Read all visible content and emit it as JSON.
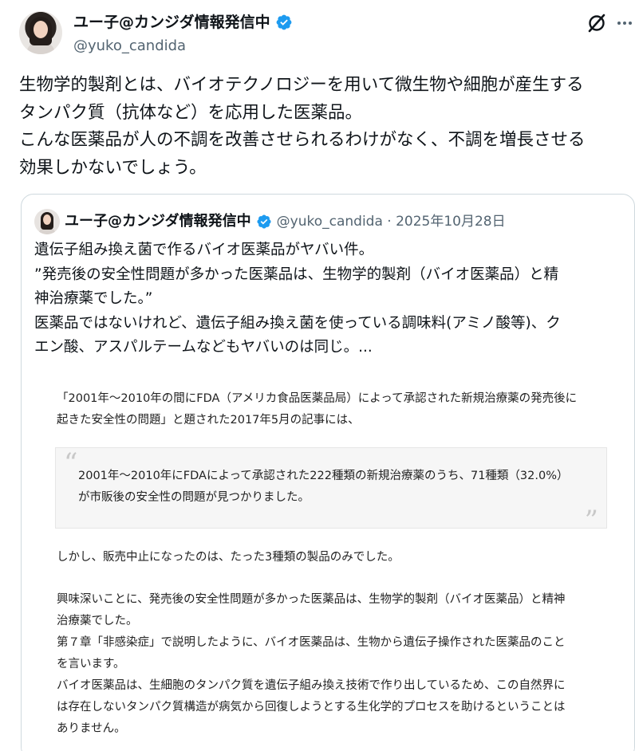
{
  "post": {
    "author": {
      "display_name": "ユー子@カンジダ情報発信中",
      "handle": "@yuko_candida"
    },
    "text": "生物学的製剤とは、バイオテクノロジーを用いて微生物や細胞が産生する\nタンパク質（抗体など）を応用した医薬品。\nこんな医薬品が人の不調を改善させられるわけがなく、不調を増長させる\n効果しかないでしょう。"
  },
  "quoted": {
    "display_name": "ユー子@カンジダ情報発信中",
    "meta": "@yuko_candida · 2025年10月28日",
    "text": "遺伝子組み換え菌で作るバイオ医薬品がヤバい件。\n”発売後の安全性問題が多かった医薬品は、生物学的製剤（バイオ医薬品）と精\n神治療薬でした。”\n医薬品ではないけれど、遺伝子組み換え菌を使っている調味料(アミノ酸等)、ク\nエン酸、アスパルテームなどもヤバいのは同じ。..."
  },
  "article": {
    "intro": "「2001年〜2010年の間にFDA（アメリカ食品医薬品局）によって承認された新規治療薬の発売後に\n起きた安全性の問題」と題された2017年5月の記事には、",
    "quote": "2001年〜2010年にFDAによって承認された222種類の新規治療薬のうち、71種類（32.0%）\nが市販後の安全性の問題が見つかりました。",
    "p1": "しかし、販売中止になったのは、たった3種類の製品のみでした。",
    "p2": "興味深いことに、発売後の安全性問題が多かった医薬品は、生物学的製剤（バイオ医薬品）と精神\n治療薬でした。\n第７章「非感染症」で説明したように、バイオ医薬品は、生物から遺伝子操作された医薬品のこと\nを言います。\nバイオ医薬品は、生細胞のタンパク質を遺伝子組み換え技術で作り出しているため、この自然界に\nは存在しないタンパク質構造が病気から回復しようとする生化学的プロセスを助けるということは\nありません。"
  },
  "icons": {
    "verified": "verified-badge-icon",
    "grok": "grok-icon",
    "more": "more-options-icon"
  },
  "colors": {
    "verified": "#1d9bf0",
    "secondary_text": "#536471"
  }
}
